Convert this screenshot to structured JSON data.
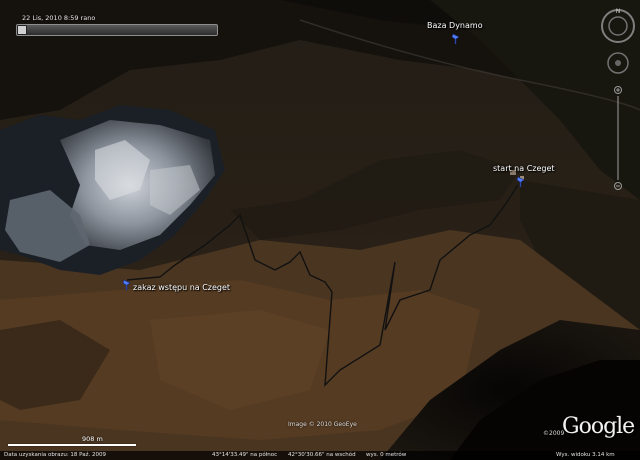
{
  "timebar": {
    "date_label": "22 Lis, 2010   8:59 rano"
  },
  "placemarks": [
    {
      "label": "Baza Dynamo"
    },
    {
      "label": "start na Czeget"
    },
    {
      "label": "zakaz wstępu na Czeget"
    }
  ],
  "imagery": {
    "copyright": "Image © 2010 GeoEye",
    "year": "©2009",
    "logo": "Google"
  },
  "scale": {
    "label": "908 m"
  },
  "statusbar": {
    "imagery_date": "Data uzyskania obrazu: 18 Paź. 2009",
    "latitude": "43°14'33.49\" na północ",
    "longitude": "42°30'30.66\" na wschód",
    "elevation": "wys.  0 metrów",
    "eye_altitude": "Wys. widoku    3.14 km"
  },
  "colors": {
    "track": "#141414",
    "pin": "#4f7bff",
    "label": "#ffffff"
  },
  "icons": [
    "pushpin-icon",
    "compass-icon",
    "look-joystick-icon",
    "move-joystick-icon",
    "zoom-slider-icon",
    "time-slider-icon"
  ]
}
